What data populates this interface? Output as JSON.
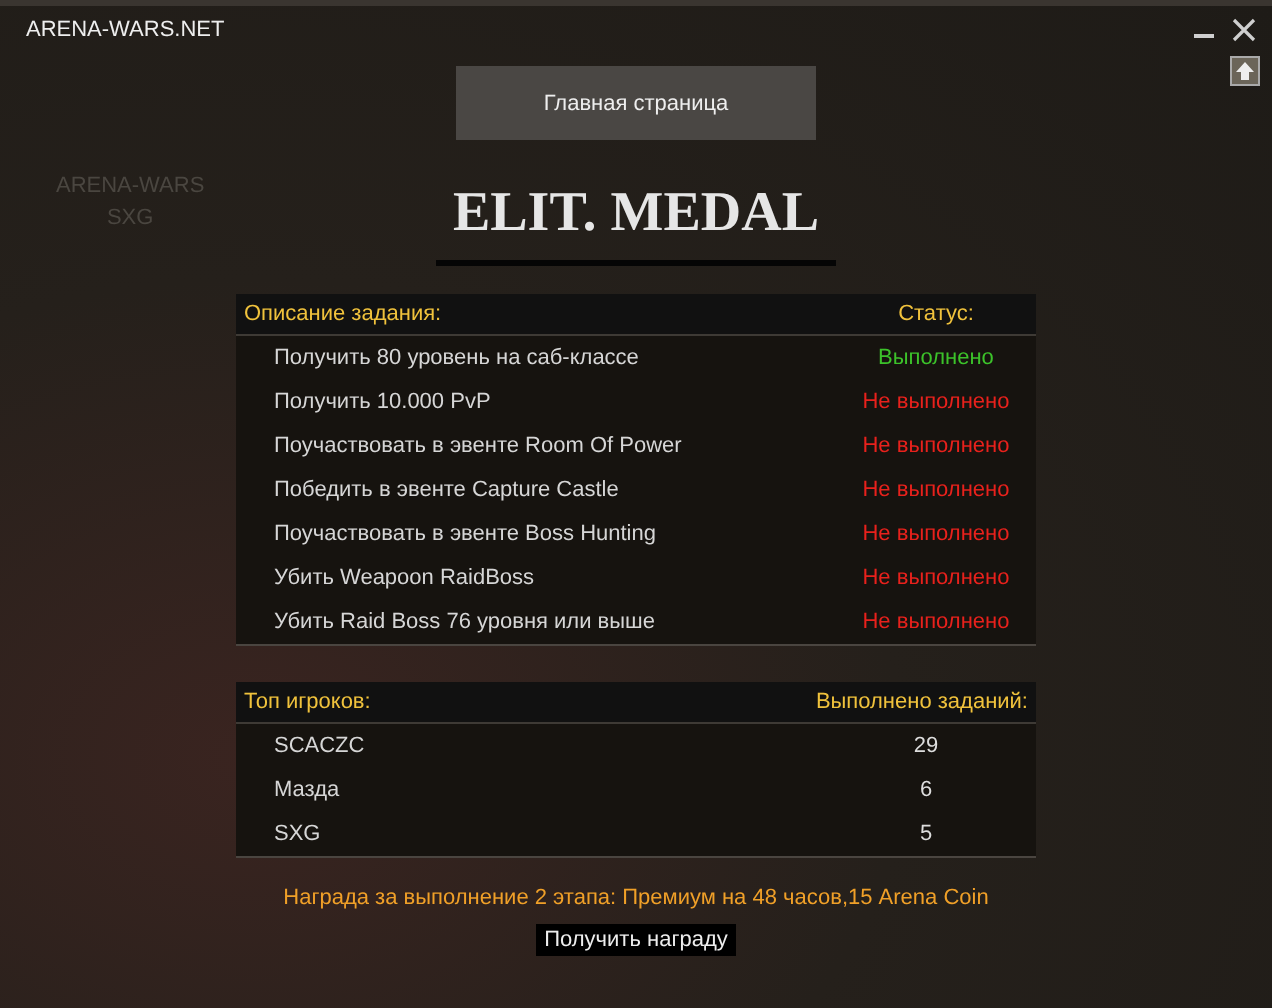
{
  "window": {
    "title": "ARENA-WARS.NET"
  },
  "home_button": "Главная страница",
  "overlay_text": [
    "ARENA-WARS",
    "SXG"
  ],
  "logo": "ELIT. MEDAL",
  "tasks": {
    "columns": [
      "Описание задания:",
      "Статус:"
    ],
    "rows": [
      {
        "task": "Получить 80 уровень на саб-классе",
        "status": "Выполнено",
        "done": true
      },
      {
        "task": "Получить 10.000 PvP",
        "status": "Не выполнено",
        "done": false
      },
      {
        "task": "Поучаствовать в эвенте Room Of Power",
        "status": "Не выполнено",
        "done": false
      },
      {
        "task": "Победить в эвенте Capture Castle",
        "status": "Не выполнено",
        "done": false
      },
      {
        "task": "Поучаствовать в эвенте Boss Hunting",
        "status": "Не выполнено",
        "done": false
      },
      {
        "task": "Убить Weapoon RaidBoss",
        "status": "Не выполнено",
        "done": false
      },
      {
        "task": "Убить Raid Boss 76 уровня или выше",
        "status": "Не выполнено",
        "done": false
      }
    ]
  },
  "top_players": {
    "columns": [
      "Топ игроков:",
      "Выполнено заданий:"
    ],
    "rows": [
      {
        "name": "SCACZC",
        "count": "29"
      },
      {
        "name": "Мазда",
        "count": "6"
      },
      {
        "name": "SXG",
        "count": "5"
      }
    ]
  },
  "reward_text": "Награда за выполнение 2 этапа: Премиум на 48 часов,15 Arena Coin",
  "claim_button": "Получить награду"
}
